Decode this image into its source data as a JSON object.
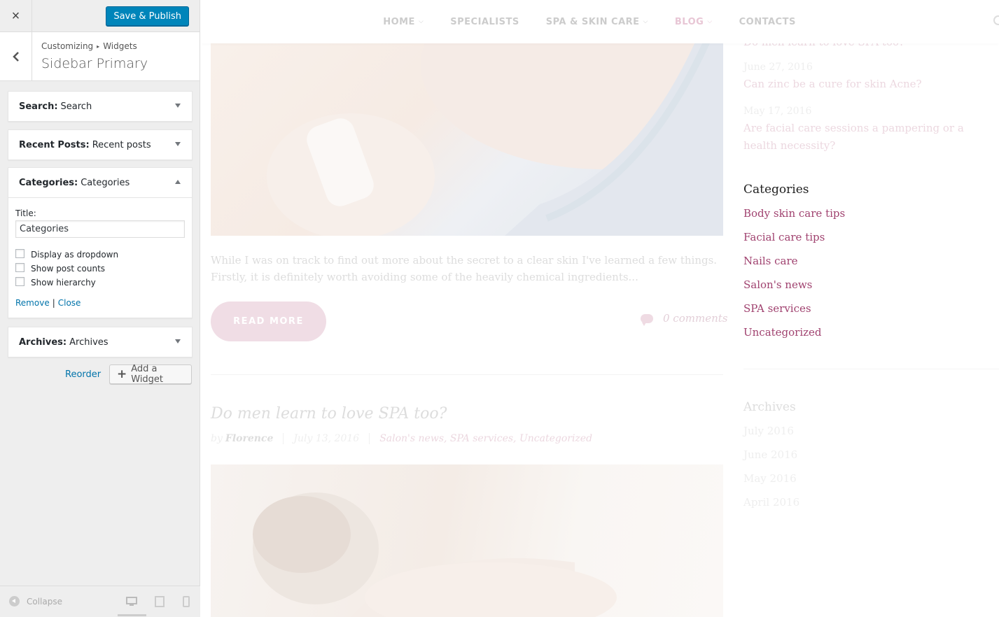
{
  "customizer": {
    "close_icon": "×",
    "save_label": "Save & Publish",
    "breadcrumb": {
      "root": "Customizing",
      "separator": "▸",
      "section": "Widgets"
    },
    "panel_title": "Sidebar Primary",
    "widgets": [
      {
        "type": "Search:",
        "name": "Search",
        "expanded": false
      },
      {
        "type": "Recent Posts:",
        "name": "Recent posts",
        "expanded": false
      },
      {
        "type": "Categories:",
        "name": "Categories",
        "expanded": true
      },
      {
        "type": "Archives:",
        "name": "Archives",
        "expanded": false
      }
    ],
    "categories_form": {
      "title_label": "Title:",
      "title_value": "Categories",
      "checkboxes": [
        {
          "label": "Display as dropdown",
          "checked": false
        },
        {
          "label": "Show post counts",
          "checked": false
        },
        {
          "label": "Show hierarchy",
          "checked": false
        }
      ],
      "remove_label": "Remove",
      "separator": "|",
      "close_label": "Close"
    },
    "reorder_label": "Reorder",
    "add_widget_plus": "+",
    "add_widget_label": "Add a Widget",
    "collapse_label": "Collapse",
    "devices": [
      "desktop-icon",
      "tablet-icon",
      "mobile-icon"
    ],
    "accent_color": "#0085ba"
  },
  "site": {
    "nav": [
      {
        "label": "HOME",
        "has_dropdown": true
      },
      {
        "label": "SPECIALISTS",
        "has_dropdown": false
      },
      {
        "label": "SPA & SKIN CARE",
        "has_dropdown": true
      },
      {
        "label": "BLOG",
        "has_dropdown": true,
        "active": true
      },
      {
        "label": "CONTACTS",
        "has_dropdown": false
      }
    ],
    "chevron": "⌵",
    "post_excerpt": "While I was on track to find out more about the secret to a clear skin I've learned a few things. Firstly, it is definitely worth avoiding some of the heavily chemical ingredients...",
    "read_more": "READ MORE",
    "comments": "0 comments",
    "next_post": {
      "title": "Do men learn to love SPA too?",
      "by": "by",
      "author": "Florence",
      "date": "July 13, 2016",
      "categories": "Salon's news, SPA services, Uncategorized"
    },
    "sidebar": {
      "recent_posts": [
        {
          "title": "Do men learn to love SPA too?"
        },
        {
          "date": "June 27, 2016",
          "title": "Can zinc be a cure for skin Acne?"
        },
        {
          "date": "May 17, 2016",
          "title": "Are facial care sessions a pampering or a health necessity?"
        }
      ],
      "categories_heading": "Categories",
      "categories": [
        "Body skin care tips",
        "Facial care tips",
        "Nails care",
        "Salon's news",
        "SPA services",
        "Uncategorized"
      ],
      "archives_heading": "Archives",
      "archives": [
        "July 2016",
        "June 2016",
        "May 2016",
        "April 2016"
      ],
      "link_color": "#a0426f"
    }
  }
}
